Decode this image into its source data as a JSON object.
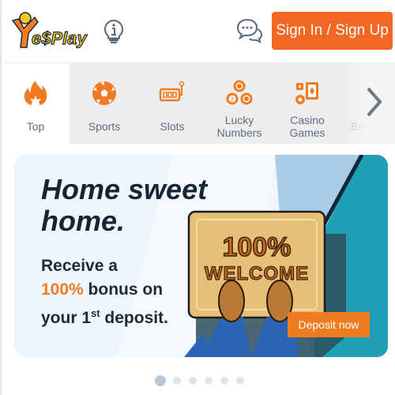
{
  "header": {
    "logo_text": "YesPlay",
    "sign_in_label": "Sign In / Sign Up"
  },
  "icons": {
    "info": "lightbulb-info-icon",
    "chat": "chat-bubbles-icon"
  },
  "nav": {
    "items": [
      {
        "label": "Top",
        "icon": "fire-icon",
        "active": true
      },
      {
        "label": "Sports",
        "icon": "soccer-ball-icon",
        "active": false
      },
      {
        "label": "Slots",
        "icon": "slot-machine-icon",
        "active": false
      },
      {
        "label": "Lucky Numbers",
        "line1": "Lucky",
        "line2": "Numbers",
        "icon": "lottery-balls-icon",
        "active": false
      },
      {
        "label": "Casino Games",
        "line1": "Casino",
        "line2": "Games",
        "icon": "casino-cards-icon",
        "active": false
      },
      {
        "label": "Bet",
        "icon": "bet-icon",
        "active": false
      }
    ],
    "next_icon": "chevron-right-icon"
  },
  "banner": {
    "headline_line1": "Home sweet",
    "headline_line2": "home.",
    "sub_line1": "Receive a",
    "sub_highlight": "100%",
    "sub_line2_rest": " bonus on",
    "sub_line3_a": "your 1",
    "sub_line3_sup": "st",
    "sub_line3_b": " deposit.",
    "mat_text_1": "100%",
    "mat_text_2": "WELCOME",
    "cta_label": "Deposit now"
  },
  "carousel": {
    "total": 6,
    "active_index": 0
  },
  "colors": {
    "brand_orange": "#f26722",
    "cta_orange": "#ef7c22",
    "text_dark": "#152536",
    "nav_text": "#5e6e7e",
    "banner_teal": "#1fa0b5"
  }
}
